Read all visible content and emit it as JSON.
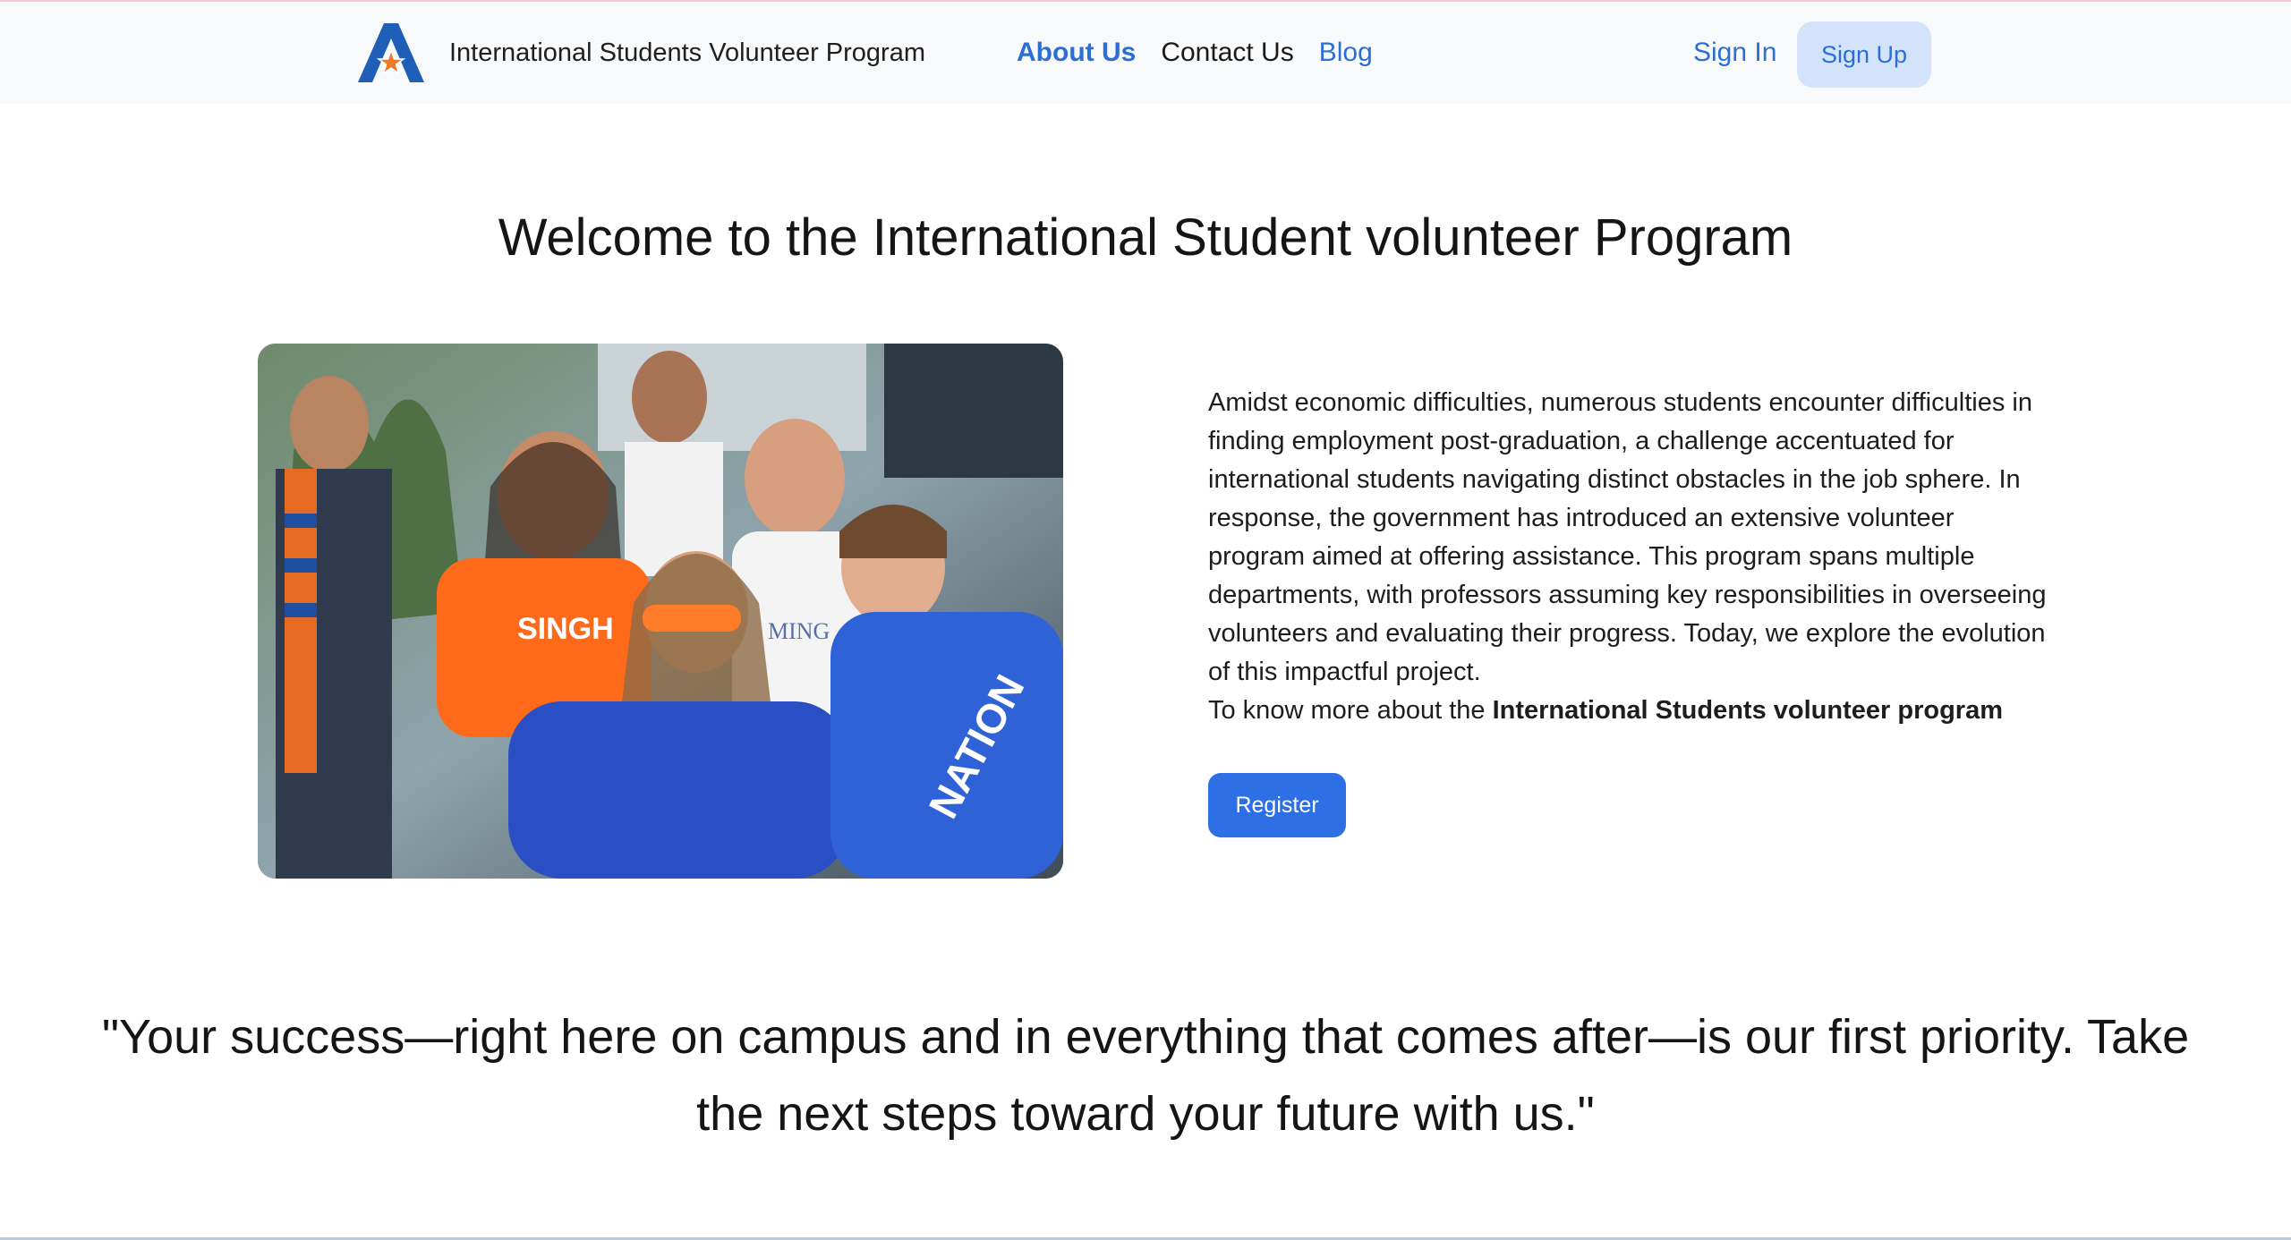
{
  "header": {
    "brand_name": "International Students Volunteer Program",
    "logo_letter": "A",
    "nav": [
      {
        "label": "About Us",
        "active": true
      },
      {
        "label": "Contact Us",
        "active": false
      },
      {
        "label": "Blog",
        "active": false
      }
    ],
    "sign_in": "Sign In",
    "sign_up": "Sign Up"
  },
  "main": {
    "welcome_title": "Welcome to the International Student volunteer Program",
    "description": "Amidst economic difficulties, numerous students encounter difficulties in finding employment post-graduation, a challenge accentuated for international students navigating distinct obstacles in the job sphere. In response, the government has introduced an extensive volunteer program aimed at offering assistance. This program spans multiple departments, with professors assuming key responsibilities in overseeing volunteers and evaluating their progress. Today, we explore the evolution of this impactful project.",
    "know_more_prefix": "To know more about the ",
    "know_more_bold": "International Students volunteer program",
    "register_label": "Register",
    "photo_texts": [
      "SINGH",
      "MING",
      "NATION"
    ]
  },
  "quote": {
    "text": "\"Your success—right here on campus and in everything that comes after—is our first priority. Take the next steps toward your future with us.\""
  },
  "colors": {
    "accent": "#2b6fd6",
    "button": "#2d6fe5",
    "signup_bg": "#d3e3fb",
    "navbar_bg": "#f8f9fa",
    "logo_blue": "#1f5fb8",
    "logo_star": "#f07b27"
  }
}
